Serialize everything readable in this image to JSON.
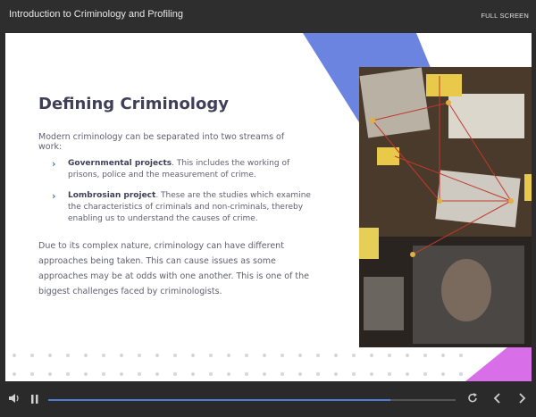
{
  "app": {
    "title": "Introduction to Criminology and Profiling",
    "fullscreen_label": "FULL SCREEN"
  },
  "slide": {
    "heading": "Defining Criminology",
    "intro": "Modern criminology can be separated into two streams of work:",
    "bullets": [
      {
        "bold": "Governmental projects",
        "text": ". This includes the working of prisons, police and the measurement of crime."
      },
      {
        "bold": "Lombrosian project",
        "text": ". These are the studies which examine the characteristics of criminals and non-criminals, thereby enabling us to understand the causes of crime."
      }
    ],
    "paragraph": "Due to its complex nature, criminology can have different approaches being taken. This can cause issues as some approaches may be at odds with one another. This is one of the biggest challenges faced by criminologists."
  },
  "player": {
    "progress": 0.84,
    "icons": [
      "volume-icon",
      "pause-icon",
      "replay-icon",
      "prev-icon",
      "next-icon"
    ]
  },
  "colors": {
    "accent_blue": "#6b84e0",
    "accent_magenta": "#d86ee8",
    "progress": "#4d7fd4",
    "heading": "#3f3f58"
  }
}
